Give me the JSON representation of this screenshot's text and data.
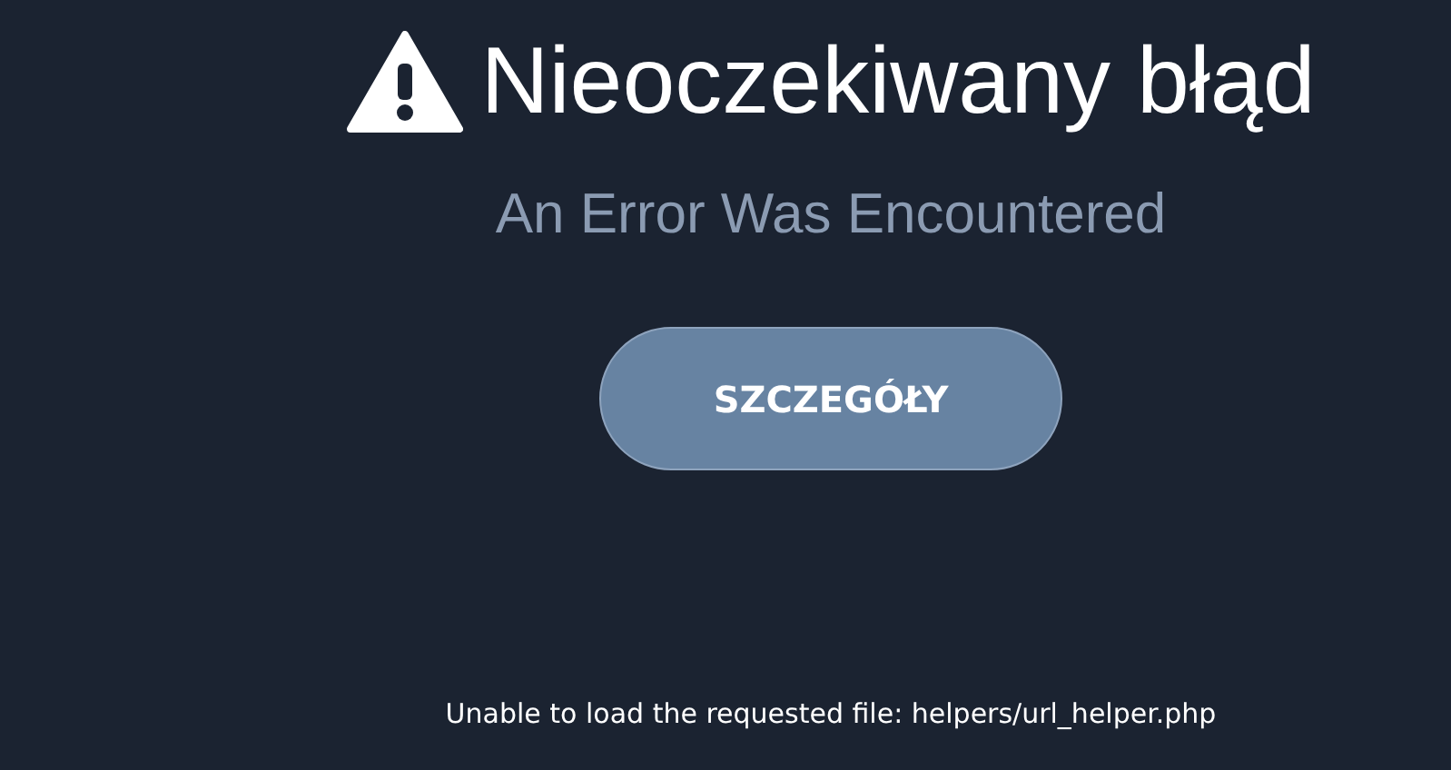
{
  "title": "Nieoczekiwany błąd",
  "subtitle": "An Error Was Encountered",
  "details_button": "SZCZEGÓŁY",
  "message": "Unable to load the requested file: helpers/url_helper.php"
}
